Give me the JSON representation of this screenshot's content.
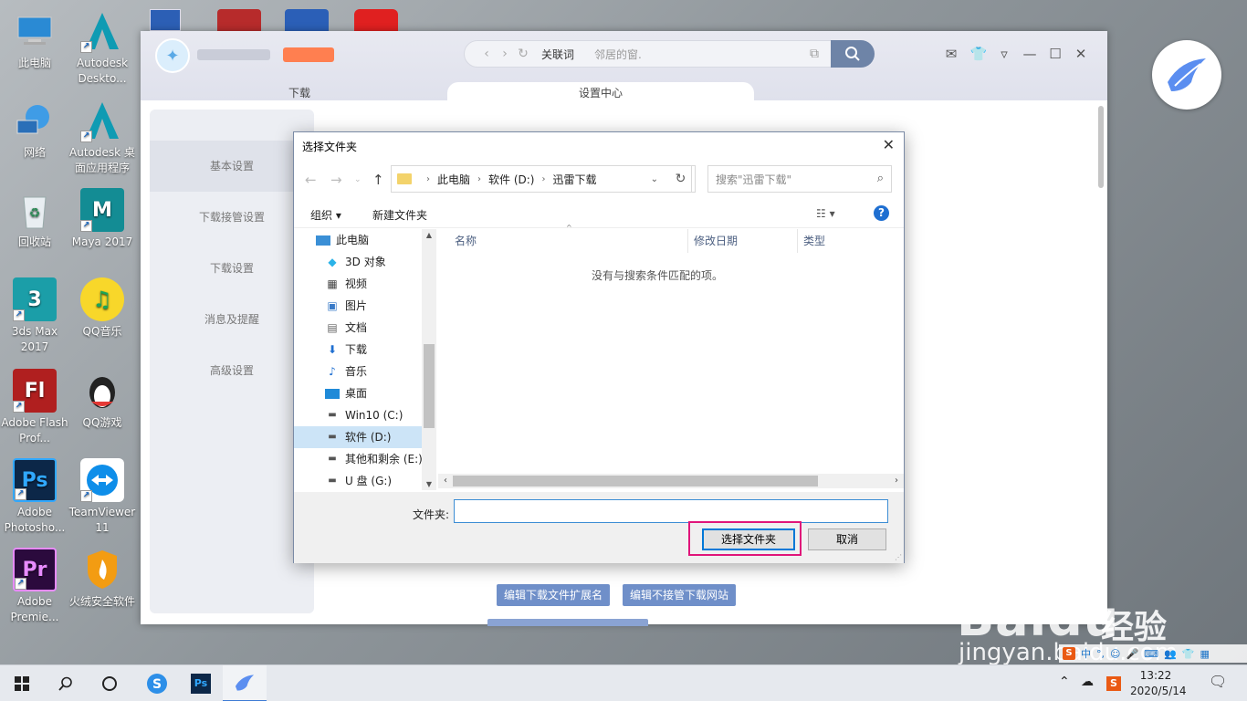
{
  "desktop": {
    "icons": [
      {
        "label": "此电脑",
        "icon": "computer-icon"
      },
      {
        "label": "Autodesk Deskto...",
        "icon": "autodesk-icon"
      },
      {
        "label": "网络",
        "icon": "network-icon"
      },
      {
        "label": "Autodesk 桌面应用程序",
        "icon": "autodesk-app-icon"
      },
      {
        "label": "回收站",
        "icon": "recycle-bin-icon"
      },
      {
        "label": "Maya 2017",
        "icon": "maya-icon"
      },
      {
        "label": "3ds Max 2017",
        "icon": "3dsmax-icon"
      },
      {
        "label": "QQ音乐",
        "icon": "qqmusic-icon"
      },
      {
        "label": "Adobe Flash Prof...",
        "icon": "flash-icon"
      },
      {
        "label": "QQ游戏",
        "icon": "qqgame-icon"
      },
      {
        "label": "Adobe Photosho...",
        "icon": "photoshop-icon"
      },
      {
        "label": "TeamViewer 11",
        "icon": "teamviewer-icon"
      },
      {
        "label": "Adobe Premie...",
        "icon": "premiere-icon"
      },
      {
        "label": "火绒安全软件",
        "icon": "huorong-icon"
      }
    ]
  },
  "app": {
    "search_keyword": "关联词",
    "search_placeholder": "邻居的窗.",
    "tabs": [
      "下载",
      "设置中心"
    ],
    "sidebar": [
      "基本设置",
      "下载接管设置",
      "下载设置",
      "消息及提醒",
      "高级设置"
    ],
    "bottom_buttons": [
      "编辑下载文件扩展名",
      "编辑不接管下载网站"
    ]
  },
  "dialog": {
    "title": "选择文件夹",
    "breadcrumb": [
      "此电脑",
      "软件 (D:)",
      "迅雷下载"
    ],
    "search_placeholder": "搜索\"迅雷下载\"",
    "toolbar": {
      "organize": "组织 ▾",
      "new_folder": "新建文件夹"
    },
    "tree": [
      {
        "label": "此电脑",
        "icon": "pc"
      },
      {
        "label": "3D 对象",
        "icon": "3d"
      },
      {
        "label": "视频",
        "icon": "video"
      },
      {
        "label": "图片",
        "icon": "picture"
      },
      {
        "label": "文档",
        "icon": "doc"
      },
      {
        "label": "下载",
        "icon": "download"
      },
      {
        "label": "音乐",
        "icon": "music"
      },
      {
        "label": "桌面",
        "icon": "desktop"
      },
      {
        "label": "Win10 (C:)",
        "icon": "drive"
      },
      {
        "label": "软件 (D:)",
        "icon": "drive"
      },
      {
        "label": "其他和剩余 (E:)",
        "icon": "drive"
      },
      {
        "label": "U 盘 (G:)",
        "icon": "drive"
      }
    ],
    "columns": [
      "名称",
      "修改日期",
      "类型"
    ],
    "empty_message": "没有与搜索条件匹配的项。",
    "folder_label": "文件夹:",
    "folder_value": "",
    "select_button": "选择文件夹",
    "cancel_button": "取消"
  },
  "watermark": {
    "brand": "Baidu",
    "suffix": "经验",
    "url": "jingyan.baidu.com"
  },
  "ime": {
    "label": "中"
  },
  "taskbar": {
    "time": "13:22",
    "date": "2020/5/14"
  },
  "colors": {
    "accent": "#0078d7",
    "highlight": "#e0157a",
    "app_button": "#6f8fc9"
  }
}
